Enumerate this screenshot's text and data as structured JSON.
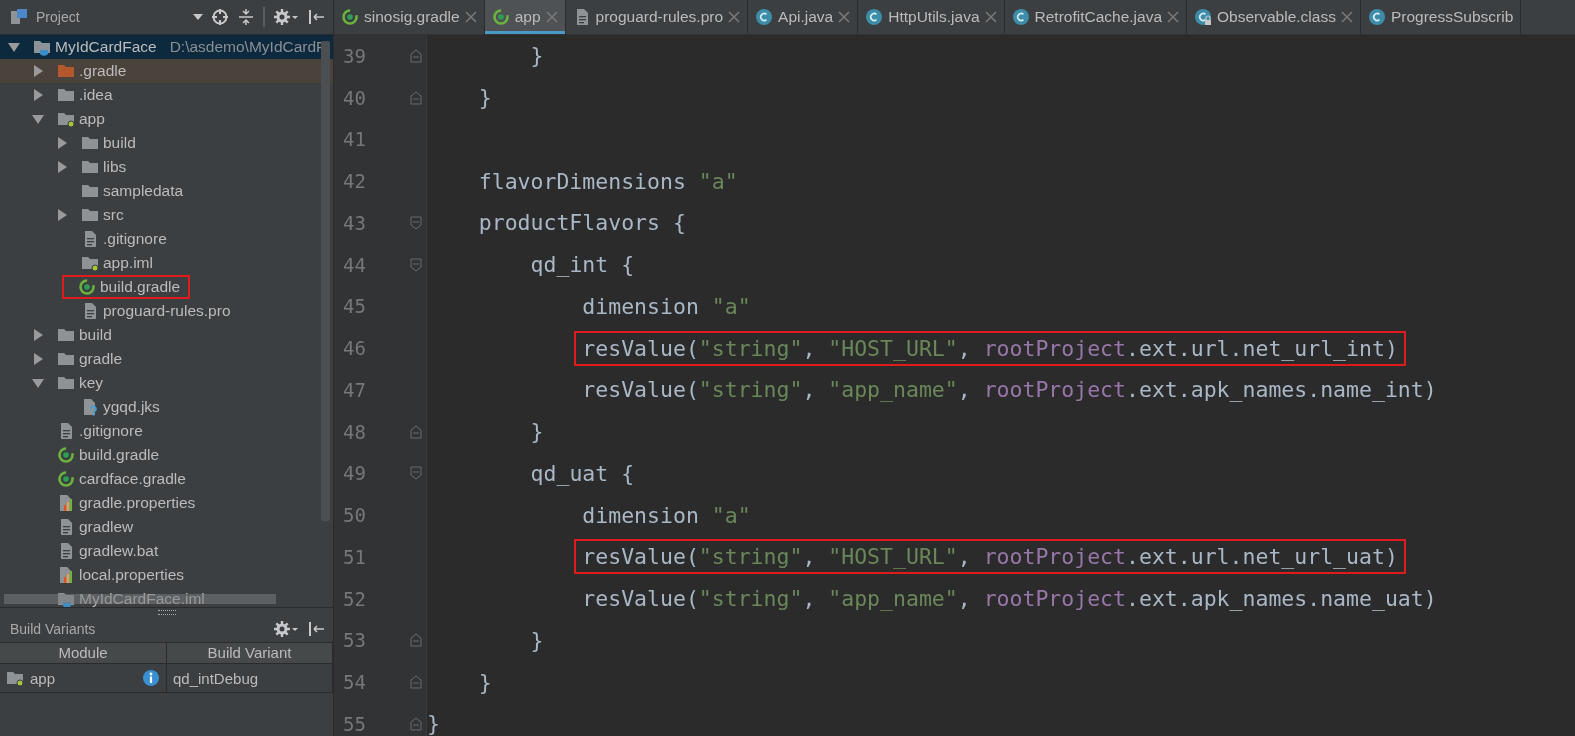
{
  "project_panel": {
    "title": "Project",
    "tree": [
      {
        "label": "MyIdCardFace",
        "path": "D:\\asdemo\\MyIdCardF",
        "kind": "root",
        "expanded": true,
        "selected": true,
        "boxed": false,
        "children": [
          {
            "label": ".gradle",
            "kind": "folder-excluded",
            "expanded": false,
            "selected": false,
            "boxed": false
          },
          {
            "label": ".idea",
            "kind": "folder",
            "expanded": false,
            "selected": false,
            "boxed": false
          },
          {
            "label": "app",
            "kind": "module",
            "expanded": true,
            "selected": false,
            "boxed": false,
            "children": [
              {
                "label": "build",
                "kind": "folder",
                "expanded": false,
                "selected": false,
                "boxed": false
              },
              {
                "label": "libs",
                "kind": "folder",
                "expanded": false,
                "selected": false,
                "boxed": false
              },
              {
                "label": "sampledata",
                "kind": "folder",
                "selected": false,
                "boxed": false
              },
              {
                "label": "src",
                "kind": "folder",
                "expanded": false,
                "selected": false,
                "boxed": false
              },
              {
                "label": ".gitignore",
                "kind": "file",
                "selected": false,
                "boxed": false
              },
              {
                "label": "app.iml",
                "kind": "module-file",
                "selected": false,
                "boxed": false
              },
              {
                "label": "build.gradle",
                "kind": "gradle",
                "selected": false,
                "boxed": true
              },
              {
                "label": "proguard-rules.pro",
                "kind": "file",
                "selected": false,
                "boxed": false
              }
            ]
          },
          {
            "label": "build",
            "kind": "folder",
            "expanded": false,
            "selected": false,
            "boxed": false
          },
          {
            "label": "gradle",
            "kind": "folder",
            "expanded": false,
            "selected": false,
            "boxed": false
          },
          {
            "label": "key",
            "kind": "folder",
            "expanded": true,
            "selected": false,
            "boxed": false,
            "children": [
              {
                "label": "ygqd.jks",
                "kind": "unknown",
                "selected": false,
                "boxed": false
              }
            ]
          },
          {
            "label": ".gitignore",
            "kind": "file",
            "selected": false,
            "boxed": false
          },
          {
            "label": "build.gradle",
            "kind": "gradle",
            "selected": false,
            "boxed": false
          },
          {
            "label": "cardface.gradle",
            "kind": "gradle",
            "selected": false,
            "boxed": false
          },
          {
            "label": "gradle.properties",
            "kind": "properties",
            "selected": false,
            "boxed": false
          },
          {
            "label": "gradlew",
            "kind": "file",
            "selected": false,
            "boxed": false
          },
          {
            "label": "gradlew.bat",
            "kind": "file",
            "selected": false,
            "boxed": false
          },
          {
            "label": "local.properties",
            "kind": "properties",
            "selected": false,
            "boxed": false
          },
          {
            "label": "MyIdCardFace.iml",
            "kind": "iml",
            "selected": false,
            "boxed": false
          }
        ]
      }
    ]
  },
  "build_variants": {
    "title": "Build Variants",
    "columns": [
      "Module",
      "Build Variant"
    ],
    "rows": [
      {
        "module": "app",
        "variant": "qd_intDebug"
      }
    ]
  },
  "editor": {
    "tabs": [
      {
        "label": "sinosig.gradle",
        "kind": "gradle",
        "selected": false,
        "closable": true
      },
      {
        "label": "app",
        "kind": "gradle",
        "selected": true,
        "closable": true
      },
      {
        "label": "proguard-rules.pro",
        "kind": "file",
        "selected": false,
        "closable": true
      },
      {
        "label": "Api.java",
        "kind": "class",
        "selected": false,
        "closable": true
      },
      {
        "label": "HttpUtils.java",
        "kind": "class",
        "selected": false,
        "closable": true
      },
      {
        "label": "RetrofitCache.java",
        "kind": "class",
        "selected": false,
        "closable": true
      },
      {
        "label": "Observable.class",
        "kind": "class-locked",
        "selected": false,
        "closable": true
      },
      {
        "label": "ProgressSubscrib",
        "kind": "class",
        "selected": false,
        "closable": false
      }
    ],
    "lines": [
      {
        "children": [
          {
            "children": [
              {
                "number": "39",
                "fold_open": false,
                "fold_close": true,
                "boxed": false,
                "tokens": [
                  {
                    "kind": "plain",
                    "text": "}"
                  }
                ]
              }
            ]
          },
          {
            "number": "40",
            "fold_open": false,
            "fold_close": true,
            "boxed": false,
            "tokens": [
              {
                "kind": "plain",
                "text": "}"
              }
            ]
          },
          {
            "number": "41",
            "fold_open": false,
            "fold_close": false
          },
          {
            "number": "42",
            "fold_open": false,
            "fold_close": false,
            "boxed": false,
            "tokens": [
              {
                "kind": "plain",
                "text": "flavorDimensions "
              },
              {
                "kind": "string",
                "text": "\"a\""
              }
            ]
          },
          {
            "number": "43",
            "fold_open": true,
            "fold_close": false,
            "boxed": false,
            "tokens": [
              {
                "kind": "plain",
                "text": "productFlavors {"
              }
            ],
            "children": [
              {
                "number": "44",
                "fold_open": true,
                "fold_close": false,
                "boxed": false,
                "tokens": [
                  {
                    "kind": "plain",
                    "text": "qd_int {"
                  }
                ],
                "children": [
                  {
                    "number": "45",
                    "fold_open": false,
                    "fold_close": false,
                    "boxed": false,
                    "tokens": [
                      {
                        "kind": "plain",
                        "text": "dimension "
                      },
                      {
                        "kind": "string",
                        "text": "\"a\""
                      }
                    ]
                  },
                  {
                    "number": "46",
                    "fold_open": false,
                    "fold_close": false,
                    "boxed": true,
                    "tokens": [
                      {
                        "kind": "plain",
                        "text": "resValue("
                      },
                      {
                        "kind": "string",
                        "text": "\"string\""
                      },
                      {
                        "kind": "plain",
                        "text": ", "
                      },
                      {
                        "kind": "string",
                        "text": "\"HOST_URL\""
                      },
                      {
                        "kind": "plain",
                        "text": ", "
                      },
                      {
                        "kind": "field",
                        "text": "rootProject"
                      },
                      {
                        "kind": "plain",
                        "text": ".ext.url.net_url_int)"
                      }
                    ]
                  },
                  {
                    "number": "47",
                    "fold_open": false,
                    "fold_close": false,
                    "boxed": false,
                    "tokens": [
                      {
                        "kind": "plain",
                        "text": "resValue("
                      },
                      {
                        "kind": "string",
                        "text": "\"string\""
                      },
                      {
                        "kind": "plain",
                        "text": ", "
                      },
                      {
                        "kind": "string",
                        "text": "\"app_name\""
                      },
                      {
                        "kind": "plain",
                        "text": ", "
                      },
                      {
                        "kind": "field",
                        "text": "rootProject"
                      },
                      {
                        "kind": "plain",
                        "text": ".ext.apk_names.name_int)"
                      }
                    ]
                  }
                ]
              },
              {
                "number": "48",
                "fold_open": false,
                "fold_close": true,
                "boxed": false,
                "tokens": [
                  {
                    "kind": "plain",
                    "text": "}"
                  }
                ]
              },
              {
                "number": "49",
                "fold_open": true,
                "fold_close": false,
                "boxed": false,
                "tokens": [
                  {
                    "kind": "plain",
                    "text": "qd_uat {"
                  }
                ],
                "children": [
                  {
                    "number": "50",
                    "fold_open": false,
                    "fold_close": false,
                    "boxed": false,
                    "tokens": [
                      {
                        "kind": "plain",
                        "text": "dimension "
                      },
                      {
                        "kind": "string",
                        "text": "\"a\""
                      }
                    ]
                  },
                  {
                    "number": "51",
                    "fold_open": false,
                    "fold_close": false,
                    "boxed": true,
                    "tokens": [
                      {
                        "kind": "plain",
                        "text": "resValue("
                      },
                      {
                        "kind": "string",
                        "text": "\"string\""
                      },
                      {
                        "kind": "plain",
                        "text": ", "
                      },
                      {
                        "kind": "string",
                        "text": "\"HOST_URL\""
                      },
                      {
                        "kind": "plain",
                        "text": ", "
                      },
                      {
                        "kind": "field",
                        "text": "rootProject"
                      },
                      {
                        "kind": "plain",
                        "text": ".ext.url.net_url_uat)"
                      }
                    ]
                  },
                  {
                    "number": "52",
                    "fold_open": false,
                    "fold_close": false,
                    "boxed": false,
                    "tokens": [
                      {
                        "kind": "plain",
                        "text": "resValue("
                      },
                      {
                        "kind": "string",
                        "text": "\"string\""
                      },
                      {
                        "kind": "plain",
                        "text": ", "
                      },
                      {
                        "kind": "string",
                        "text": "\"app_name\""
                      },
                      {
                        "kind": "plain",
                        "text": ", "
                      },
                      {
                        "kind": "field",
                        "text": "rootProject"
                      },
                      {
                        "kind": "plain",
                        "text": ".ext.apk_names.name_uat)"
                      }
                    ]
                  }
                ]
              },
              {
                "number": "53",
                "fold_open": false,
                "fold_close": true,
                "boxed": false,
                "tokens": [
                  {
                    "kind": "plain",
                    "text": "}"
                  }
                ]
              }
            ]
          },
          {
            "number": "54",
            "fold_open": false,
            "fold_close": true,
            "boxed": false,
            "tokens": [
              {
                "kind": "plain",
                "text": "}"
              }
            ]
          }
        ]
      },
      {
        "number": "55",
        "fold_open": false,
        "fold_close": true,
        "boxed": false,
        "tokens": [
          {
            "kind": "plain",
            "text": "}"
          }
        ]
      }
    ]
  }
}
